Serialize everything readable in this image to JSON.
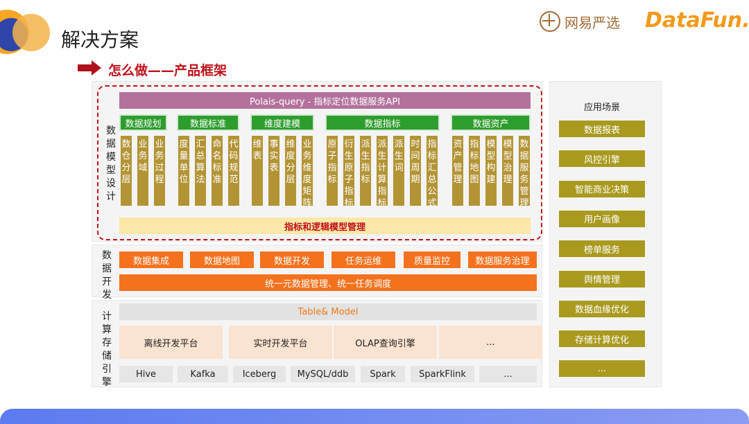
{
  "header": {
    "title": "解决方案",
    "subtitle": "怎么做——产品框架",
    "logo_yanxuan": "网易严选",
    "logo_datafun": "DataFun."
  },
  "colors": {
    "api": "#b3719c",
    "category": "#2d9d2d",
    "item": "#b39435",
    "management": "#fbe8a8",
    "dev": "#f4721e",
    "scene": "#a99a1f",
    "dashed_border": "#c0111a"
  },
  "modeling": {
    "side_label": "数据模型设计",
    "api_bar": "Polais-query - 指标定位数据服务API",
    "categories": [
      {
        "label": "数据规划",
        "items": [
          "数仓分层",
          "业务域",
          "业务过程"
        ]
      },
      {
        "label": "数据标准",
        "items": [
          "度量单位",
          "汇总算法",
          "命名标准",
          "代码规范"
        ]
      },
      {
        "label": "维度建模",
        "items": [
          "维表",
          "事实表",
          "维度分层",
          "业务维度矩阵"
        ]
      },
      {
        "label": "数据指标",
        "items": [
          "原子指标",
          "衍生原子指标",
          "派生指标",
          "派生计算指标",
          "派生词",
          "时间周期",
          "指标汇总公式"
        ]
      },
      {
        "label": "数据资产",
        "items": [
          "资产管理",
          "指标地图",
          "模型构建",
          "模型治理",
          "数据服务管理"
        ]
      }
    ],
    "management_bar": "指标和逻辑模型管理"
  },
  "development": {
    "side_label": "数据开发",
    "items": [
      "数据集成",
      "数据地图",
      "数据开发",
      "任务运维",
      "质量监控",
      "数据服务治理"
    ],
    "unified_bar": "统一元数据管理、统一任务调度"
  },
  "compute": {
    "side_label": "计算存储引擎",
    "model_bar": "Table& Model",
    "platforms": [
      "离线开发平台",
      "实时开发平台",
      "OLAP查询引擎",
      "..."
    ],
    "engines": [
      "Hive",
      "Kafka",
      "Iceberg",
      "MySQL/ddb",
      "Spark",
      "SparkFlink",
      "..."
    ]
  },
  "scenarios": {
    "title": "应用场景",
    "items": [
      "数据报表",
      "风控引擎",
      "智能商业决策",
      "用户画像",
      "榜单服务",
      "舆情管理",
      "数据血缘优化",
      "存储计算优化",
      "..."
    ]
  }
}
